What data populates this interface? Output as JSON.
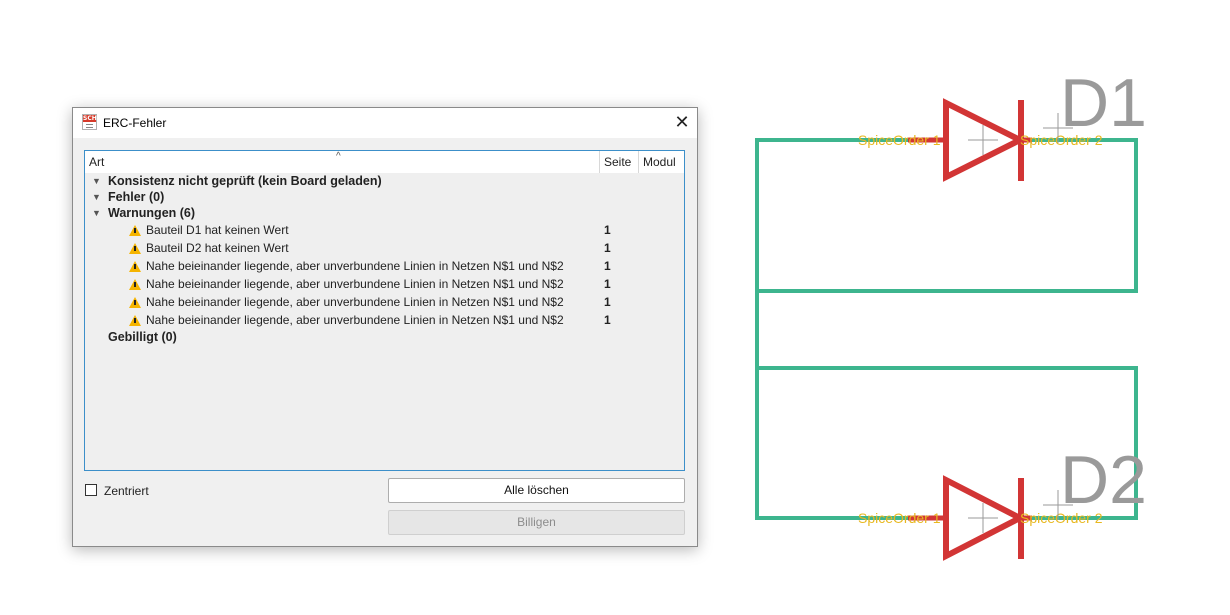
{
  "schematic": {
    "colors": {
      "wire": "#3db58e",
      "part": "#d23535",
      "pin_label": "#e8b820",
      "ref_label": "#9a9a9a"
    },
    "parts": [
      {
        "ref": "D1",
        "pin1_label": "SpiceOrder 1",
        "pin2_label": "SpiceOrder 2"
      },
      {
        "ref": "D2",
        "pin1_label": "SpiceOrder 1",
        "pin2_label": "SpiceOrder 2"
      }
    ]
  },
  "dialog": {
    "title": "ERC-Fehler",
    "app_icon_text": "SCH",
    "close_glyph": "✕",
    "tree": {
      "sort_glyph": "^",
      "columns": {
        "art": "Art",
        "seite": "Seite",
        "modul": "Modul"
      },
      "groups": [
        {
          "label": "Konsistenz nicht geprüft (kein Board geladen)",
          "expanded": true
        },
        {
          "label": "Fehler (0)",
          "expanded": true
        },
        {
          "label": "Warnungen (6)",
          "expanded": true,
          "items": [
            {
              "text": "Bauteil D1 hat keinen Wert",
              "page": "1"
            },
            {
              "text": "Bauteil D2 hat keinen Wert",
              "page": "1"
            },
            {
              "text": "Nahe beieinander liegende, aber unverbundene Linien in Netzen N$1 und N$2",
              "page": "1"
            },
            {
              "text": "Nahe beieinander liegende, aber unverbundene Linien in Netzen N$1 und N$2",
              "page": "1"
            },
            {
              "text": "Nahe beieinander liegende, aber unverbundene Linien in Netzen N$1 und N$2",
              "page": "1"
            },
            {
              "text": "Nahe beieinander liegende, aber unverbundene Linien in Netzen N$1 und N$2",
              "page": "1"
            }
          ]
        },
        {
          "label": "Gebilligt (0)",
          "expanded": false
        }
      ],
      "caret_glyph": "▼"
    },
    "checkbox": {
      "label": "Zentriert",
      "checked": false
    },
    "buttons": {
      "clear_all": "Alle löschen",
      "approve": "Billigen"
    },
    "accent": "#3c8fc9",
    "warning_color": "#f5b400"
  }
}
